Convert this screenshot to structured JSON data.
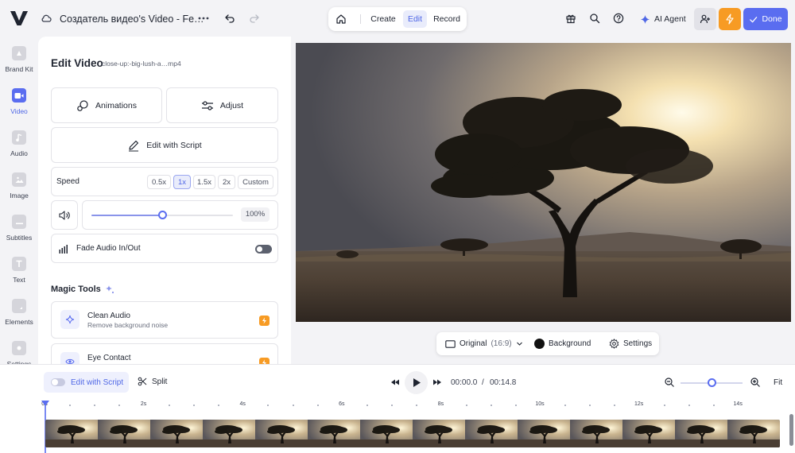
{
  "topbar": {
    "project_title": "Создатель видео's Video - Fe…",
    "mode_tabs": [
      {
        "label": "Create",
        "active": false
      },
      {
        "label": "Edit",
        "active": true
      },
      {
        "label": "Record",
        "active": false
      }
    ],
    "ai_agent_label": "AI Agent",
    "done_label": "Done",
    "accent_color": "#5a6df0",
    "bolt_color": "#f79b24"
  },
  "rail": {
    "items": [
      {
        "label": "Brand Kit",
        "icon": "brand-kit-icon",
        "active": false
      },
      {
        "label": "Video",
        "icon": "video-camera-icon",
        "active": true
      },
      {
        "label": "Audio",
        "icon": "music-note-icon",
        "active": false
      },
      {
        "label": "Image",
        "icon": "image-icon",
        "active": false
      },
      {
        "label": "Subtitles",
        "icon": "subtitles-icon",
        "active": false
      },
      {
        "label": "Text",
        "icon": "text-icon",
        "active": false
      },
      {
        "label": "Elements",
        "icon": "elements-icon",
        "active": false
      },
      {
        "label": "Settings",
        "icon": "settings-icon",
        "active": false
      }
    ]
  },
  "panel": {
    "title": "Edit Video",
    "filename": "close-up:-big-lush-a…mp4",
    "animations_label": "Animations",
    "adjust_label": "Adjust",
    "edit_script_label": "Edit with Script",
    "speed": {
      "label": "Speed",
      "options": [
        "0.5x",
        "1x",
        "1.5x",
        "2x",
        "Custom"
      ],
      "selected": "1x"
    },
    "volume": {
      "value": 100,
      "display": "100%",
      "level_fraction": 0.5
    },
    "fade": {
      "label": "Fade Audio In/Out",
      "enabled": false
    },
    "magic_tools": {
      "title": "Magic Tools",
      "tools": [
        {
          "title": "Clean Audio",
          "subtitle": "Remove background noise",
          "icon": "sparkle-icon"
        },
        {
          "title": "Eye Contact",
          "subtitle": "",
          "icon": "eye-icon"
        }
      ]
    }
  },
  "preview": {
    "ratio_label": "Original",
    "ratio_value": "(16:9)",
    "background_label": "Background",
    "settings_label": "Settings"
  },
  "timeline": {
    "edit_script_label": "Edit with Script",
    "split_label": "Split",
    "current_time": "00:00.0",
    "separator": "/",
    "total_time": "00:14.8",
    "fit_label": "Fit",
    "zoom_fraction": 0.5,
    "ruler_labels": [
      "0s",
      "2s",
      "4s",
      "6s",
      "8s",
      "10s",
      "12s",
      "14s"
    ],
    "ruler_seconds": [
      0,
      2,
      4,
      6,
      8,
      10,
      12,
      14
    ],
    "duration_seconds": 14.8
  }
}
